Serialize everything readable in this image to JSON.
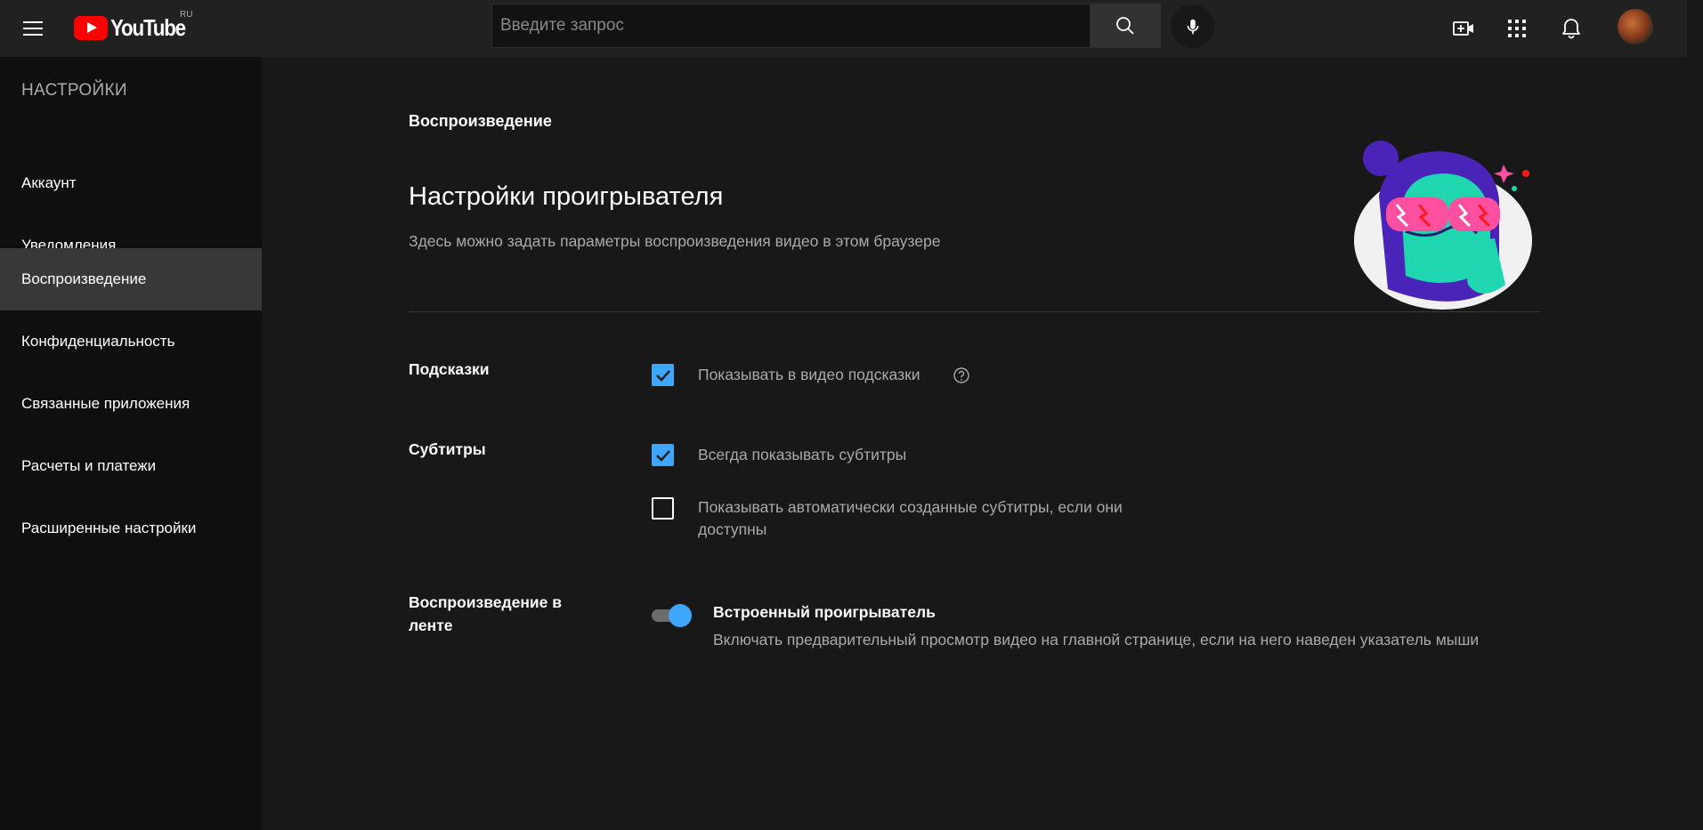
{
  "header": {
    "logo_text": "YouTube",
    "logo_country": "RU",
    "search_placeholder": "Введите запрос",
    "icons": [
      "menu-icon",
      "search-icon",
      "microphone-icon",
      "create-video-icon",
      "apps-grid-icon",
      "notifications-bell-icon",
      "avatar"
    ]
  },
  "sidebar": {
    "title": "НАСТРОЙКИ",
    "items": [
      {
        "label": "Аккаунт",
        "active": false
      },
      {
        "label": "Уведомления",
        "active": false
      },
      {
        "label": "Воспроизведение",
        "active": true
      },
      {
        "label": "Конфиденциальность",
        "active": false
      },
      {
        "label": "Связанные приложения",
        "active": false
      },
      {
        "label": "Расчеты и платежи",
        "active": false
      },
      {
        "label": "Расширенные настройки",
        "active": false
      }
    ]
  },
  "main": {
    "section": "Воспроизведение",
    "title": "Настройки проигрывателя",
    "description": "Здесь можно задать параметры воспроизведения видео в этом браузере",
    "annotations": {
      "label": "Подсказки",
      "option": {
        "text": "Показывать в видео подсказки",
        "checked": true
      }
    },
    "subtitles": {
      "label": "Субтитры",
      "options": [
        {
          "text": "Всегда показывать субтитры",
          "checked": true
        },
        {
          "text": "Показывать автоматически созданные субтитры, если они доступны",
          "checked": false
        }
      ]
    },
    "inline_playback": {
      "label": "Воспроизведение в ленте",
      "toggle_title": "Встроенный проигрыватель",
      "toggle_description": "Включать предварительный просмотр видео на главной странице, если на него наведен указатель мыши",
      "enabled": true
    }
  },
  "colors": {
    "accent": "#3ea6ff",
    "brand": "#ff0000",
    "background": "#181818",
    "sidebar_bg": "#0f0f0f",
    "header_bg": "#212121"
  }
}
